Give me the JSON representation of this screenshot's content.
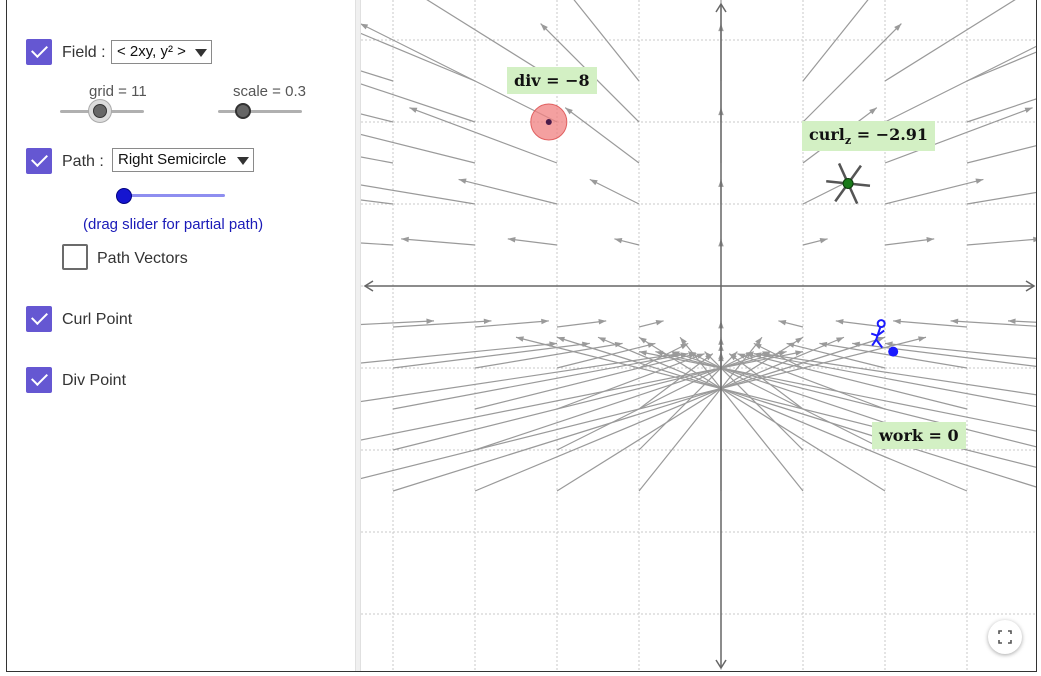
{
  "field": {
    "checked": true,
    "label": "Field :",
    "selected": "< 2xy, y² >"
  },
  "sliders": {
    "grid_caption": "grid = 11",
    "scale_caption": "scale = 0.3",
    "grid_value": 11,
    "scale_value": 0.3
  },
  "path": {
    "checked": true,
    "label": "Path :",
    "selected": "Right Semicircle",
    "partial_path_fraction": 0,
    "hint": "(drag slider for partial path)"
  },
  "path_vectors": {
    "checked": false,
    "label": "Path Vectors"
  },
  "curl_point": {
    "checked": true,
    "label": "Curl Point"
  },
  "div_point": {
    "checked": true,
    "label": "Div Point"
  },
  "graph": {
    "div_label": "div = −8",
    "curl_label_main": "curl",
    "curl_label_sub": "z",
    "curl_label_value": " = −2.91",
    "work_label": "work = 0",
    "div_point": {
      "x": -2.1,
      "y": 2.0
    },
    "curl_point": {
      "x": 1.55,
      "y": 1.25
    },
    "path_end_point": {
      "x": 2.1,
      "y": -0.8
    },
    "vector_field": "< 2xy, y² >",
    "grid_spacing_units": 1,
    "colors": {
      "arrow": "#9a9a9a",
      "div_fill": "#f08080",
      "curl_point": "#1a7a1a",
      "path": "#1a1aff",
      "label_bg": "#d3f0c4"
    }
  },
  "icons": {
    "checkbox": "checkmark-icon",
    "dropdown": "caret-down-icon",
    "fullscreen": "fullscreen-icon"
  }
}
